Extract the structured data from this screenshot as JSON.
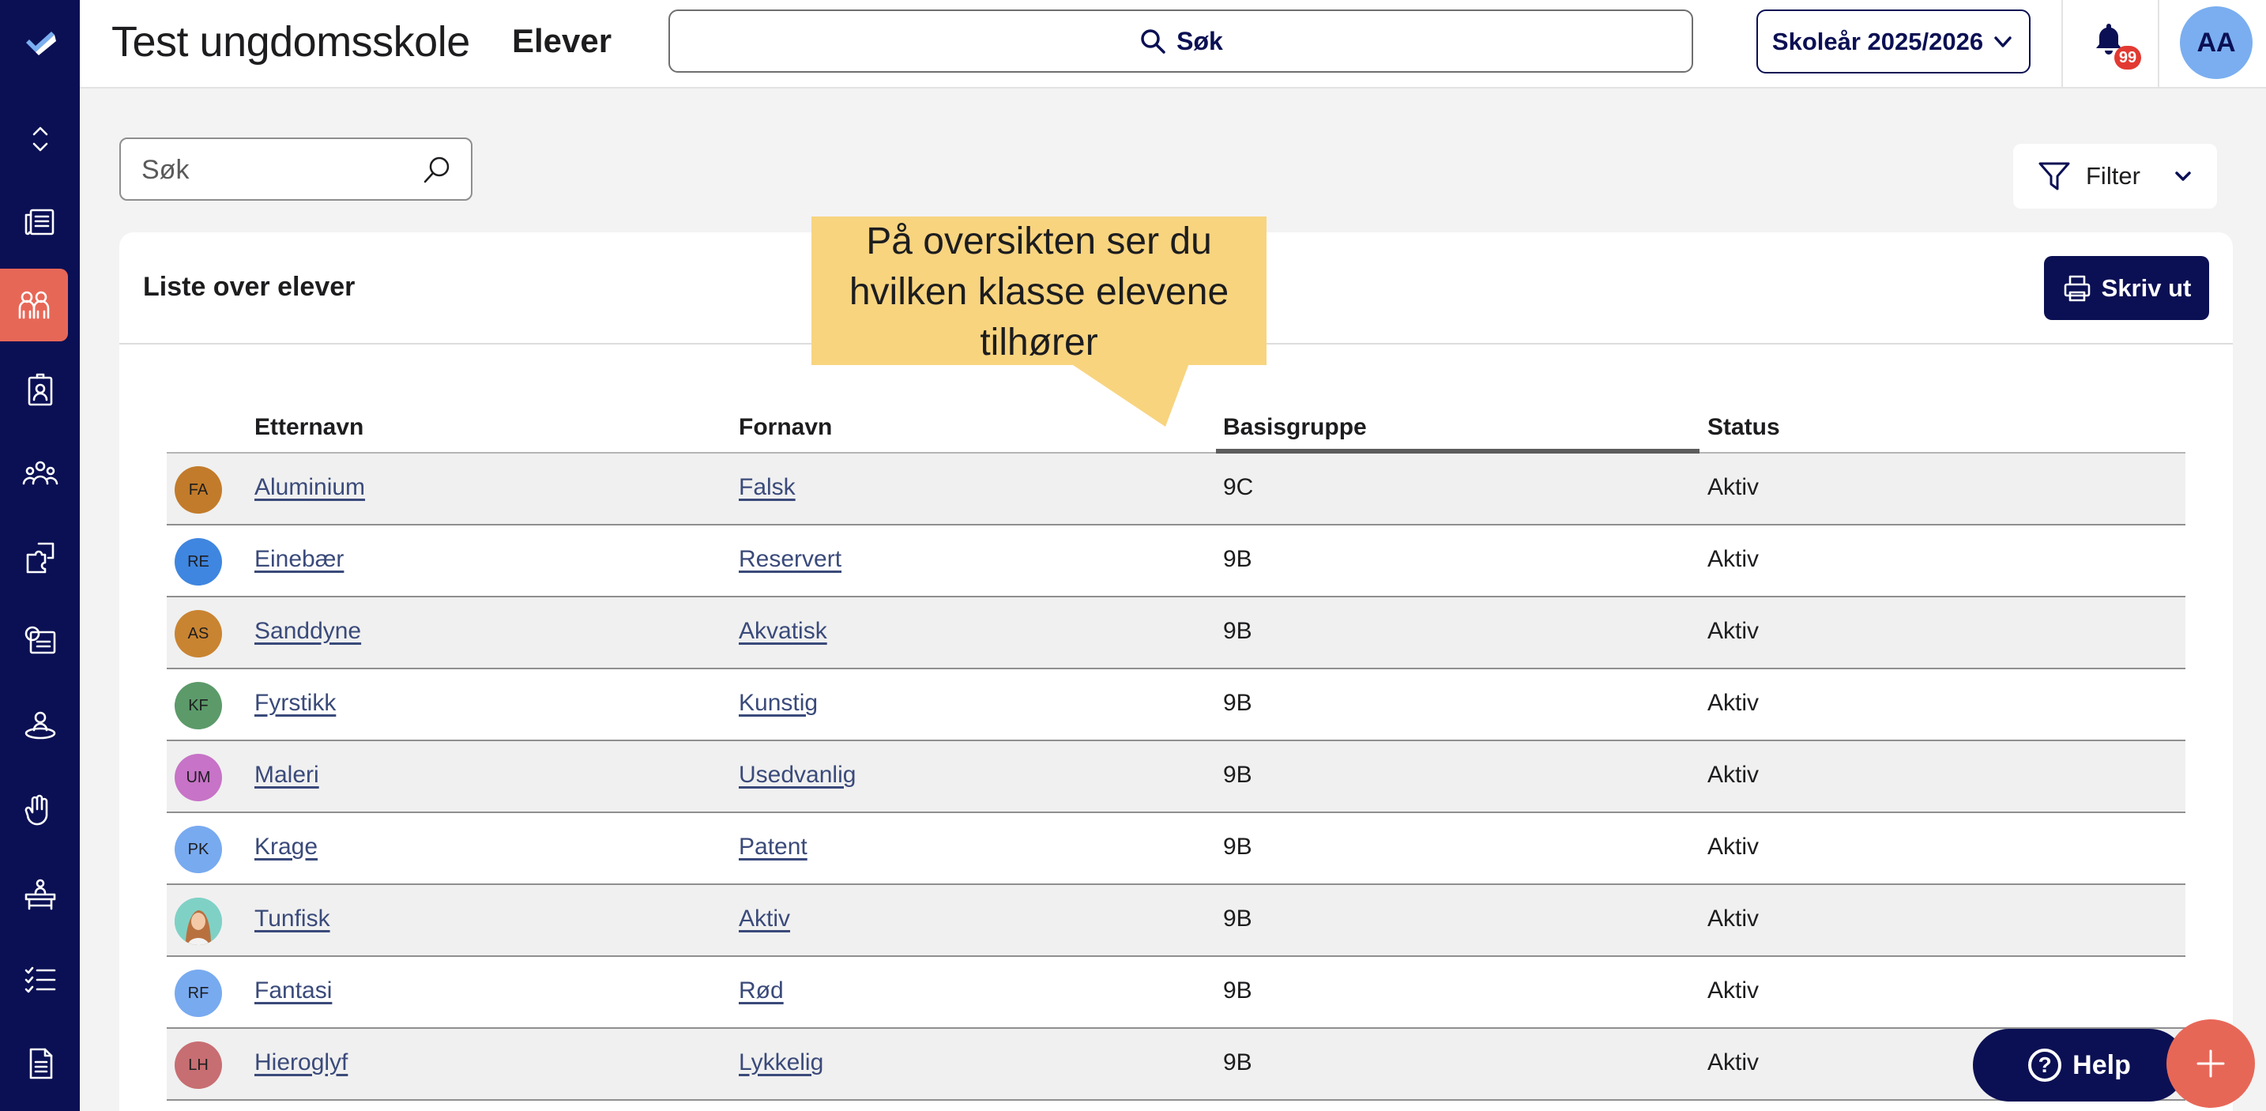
{
  "header": {
    "school_name": "Test ungdomsskole",
    "page_title": "Elever",
    "global_search_label": "Søk",
    "school_year": "Skoleår 2025/2026",
    "notification_count": "99",
    "user_initials": "AA"
  },
  "toolbar": {
    "search_placeholder": "Søk",
    "filter_label": "Filter"
  },
  "card": {
    "title": "Liste over elever",
    "print_label": "Skriv ut"
  },
  "table": {
    "columns": [
      "Etternavn",
      "Fornavn",
      "Basisgruppe",
      "Status"
    ],
    "sorted_column": "Basisgruppe",
    "rows": [
      {
        "initials": "FA",
        "avatar_color": "#c27b2a",
        "last_name": "Aluminium",
        "first_name": "Falsk",
        "group": "9C",
        "status": "Aktiv"
      },
      {
        "initials": "RE",
        "avatar_color": "#3f86e0",
        "last_name": "Einebær",
        "first_name": "Reservert",
        "group": "9B",
        "status": "Aktiv"
      },
      {
        "initials": "AS",
        "avatar_color": "#c98431",
        "last_name": "Sanddyne",
        "first_name": "Akvatisk",
        "group": "9B",
        "status": "Aktiv"
      },
      {
        "initials": "KF",
        "avatar_color": "#5c9a6a",
        "last_name": "Fyrstikk",
        "first_name": "Kunstig",
        "group": "9B",
        "status": "Aktiv"
      },
      {
        "initials": "UM",
        "avatar_color": "#c773c7",
        "last_name": "Maleri",
        "first_name": "Usedvanlig",
        "group": "9B",
        "status": "Aktiv"
      },
      {
        "initials": "PK",
        "avatar_color": "#78aaf0",
        "last_name": "Krage",
        "first_name": "Patent",
        "group": "9B",
        "status": "Aktiv"
      },
      {
        "initials": "",
        "avatar_color": "#7fd1c6",
        "avatar_photo": true,
        "last_name": "Tunfisk",
        "first_name": "Aktiv",
        "group": "9B",
        "status": "Aktiv"
      },
      {
        "initials": "RF",
        "avatar_color": "#78aaf0",
        "last_name": "Fantasi",
        "first_name": "Rød",
        "group": "9B",
        "status": "Aktiv"
      },
      {
        "initials": "LH",
        "avatar_color": "#c76e72",
        "last_name": "Hieroglyf",
        "first_name": "Lykkelig",
        "group": "9B",
        "status": "Aktiv"
      }
    ]
  },
  "callout": {
    "lines": [
      "På oversikten ser du",
      "hvilken klasse elevene",
      "tilhører"
    ]
  },
  "help": {
    "label": "Help"
  },
  "sidebar": {
    "items": [
      "logo-icon",
      "expand-collapse-icon",
      "newspaper-icon",
      "students-icon",
      "badge-icon",
      "groups-icon",
      "puzzle-icon",
      "assessment-icon",
      "person-orbit-icon",
      "hand-icon",
      "desk-icon",
      "checklist-icon",
      "document-icon"
    ]
  },
  "colors": {
    "navy": "#0b1054",
    "accent": "#e76757",
    "callout": "#f8d47f"
  }
}
